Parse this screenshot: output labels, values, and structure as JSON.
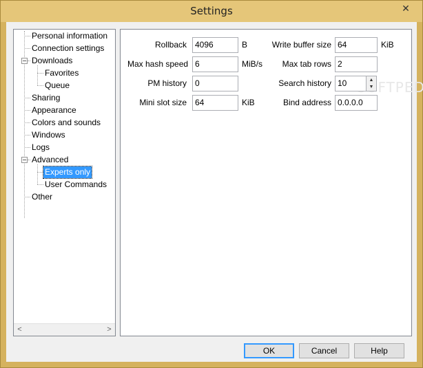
{
  "window": {
    "title": "Settings",
    "close_glyph": "✕"
  },
  "tree": {
    "items": [
      {
        "label": "Personal information"
      },
      {
        "label": "Connection settings"
      },
      {
        "label": "Downloads"
      },
      {
        "label": "Favorites"
      },
      {
        "label": "Queue"
      },
      {
        "label": "Sharing"
      },
      {
        "label": "Appearance"
      },
      {
        "label": "Colors and sounds"
      },
      {
        "label": "Windows"
      },
      {
        "label": "Logs"
      },
      {
        "label": "Advanced"
      },
      {
        "label": "Experts only",
        "selected": true
      },
      {
        "label": "User Commands"
      },
      {
        "label": "Other"
      }
    ],
    "expander_glyph": "−",
    "scroll_left": "<",
    "scroll_right": ">"
  },
  "fields": {
    "rollback": {
      "label": "Rollback",
      "value": "4096",
      "unit": "B"
    },
    "max_hash_speed": {
      "label": "Max hash speed",
      "value": "6",
      "unit": "MiB/s"
    },
    "pm_history": {
      "label": "PM history",
      "value": "0"
    },
    "mini_slot_size": {
      "label": "Mini slot size",
      "value": "64",
      "unit": "KiB"
    },
    "write_buffer_size": {
      "label": "Write buffer size",
      "value": "64",
      "unit": "KiB"
    },
    "max_tab_rows": {
      "label": "Max tab rows",
      "value": "2"
    },
    "search_history": {
      "label": "Search history",
      "value": "10",
      "spin_up": "▲",
      "spin_down": "▼"
    },
    "bind_address": {
      "label": "Bind address",
      "value": "0.0.0.0"
    }
  },
  "watermark": "SOFTPEDIA",
  "buttons": {
    "ok": "OK",
    "cancel": "Cancel",
    "help": "Help"
  }
}
